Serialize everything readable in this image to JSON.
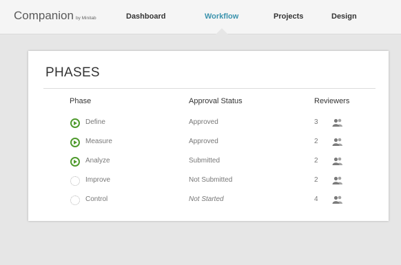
{
  "app": {
    "brand_name": "Companion",
    "brand_by": "by Minitab"
  },
  "nav": {
    "items": [
      {
        "label": "Dashboard",
        "active": false
      },
      {
        "label": "Workflow",
        "active": true
      },
      {
        "label": "Projects",
        "active": false
      },
      {
        "label": "Design",
        "active": false
      }
    ]
  },
  "phases": {
    "title": "PHASES",
    "columns": {
      "phase": "Phase",
      "approval_status": "Approval Status",
      "reviewers": "Reviewers"
    },
    "rows": [
      {
        "phase": "Define",
        "status": "Approved",
        "reviewers": "3",
        "icon": "play-circle-icon"
      },
      {
        "phase": "Measure",
        "status": "Approved",
        "reviewers": "2",
        "icon": "play-circle-icon"
      },
      {
        "phase": "Analyze",
        "status": "Submitted",
        "reviewers": "2",
        "icon": "play-circle-icon"
      },
      {
        "phase": "Improve",
        "status": "Not Submitted",
        "reviewers": "2",
        "icon": "dotted-circle-icon"
      },
      {
        "phase": "Control",
        "status": "Not Started",
        "reviewers": "4",
        "icon": "dotted-circle-icon"
      }
    ]
  },
  "colors": {
    "accent": "#3b93ad",
    "complete": "#4e9a2c",
    "pending": "#b5b5b5"
  }
}
